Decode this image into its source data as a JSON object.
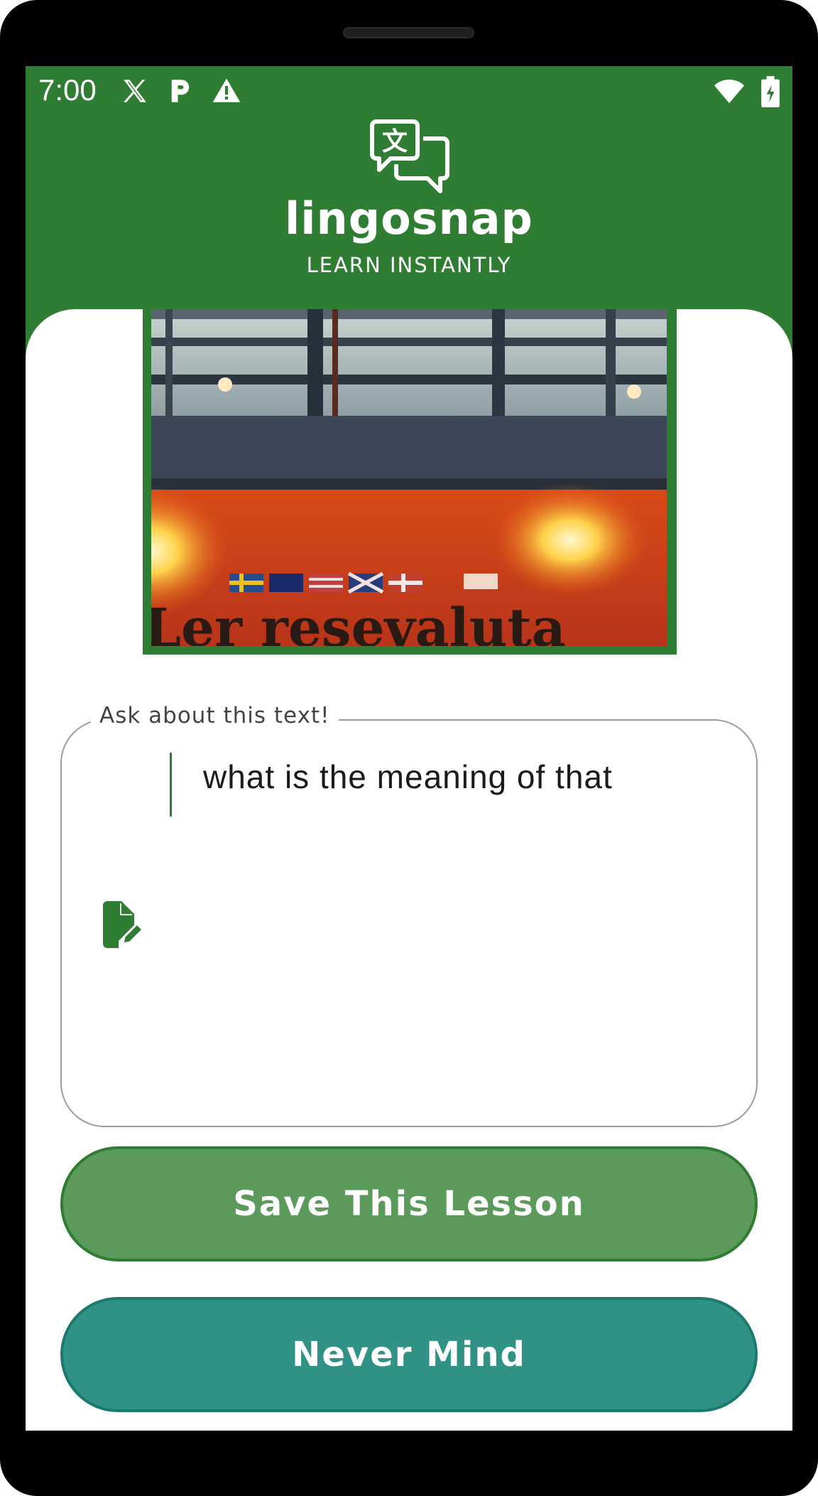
{
  "status_bar": {
    "time": "7:00",
    "icons": [
      "x-logo-icon",
      "parking-icon",
      "warning-icon",
      "wifi-icon",
      "battery-charging-icon"
    ]
  },
  "header": {
    "brand_name": "lingosnap",
    "tagline": "LEARN INSTANTLY",
    "logo_icon": "translate-chat-bubbles-icon"
  },
  "photo": {
    "visible_text": "Ler resevaluta"
  },
  "question": {
    "label": "Ask about this text!",
    "value": "what is the meaning of that",
    "icon": "edit-note-icon"
  },
  "buttons": {
    "save_label": "Save This Lesson",
    "cancel_label": "Never Mind"
  },
  "colors": {
    "header_green": "#2f7d32",
    "save_button": "#5b9a5a",
    "cancel_button": "#2f9284",
    "outline_gray": "#9e9e9e"
  }
}
